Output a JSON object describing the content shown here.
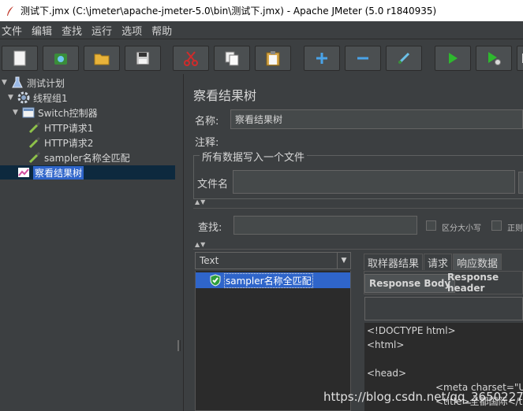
{
  "window": {
    "title": "测试下.jmx (C:\\jmeter\\apache-jmeter-5.0\\bin\\测试下.jmx) - Apache JMeter (5.0 r1840935)"
  },
  "menubar": {
    "items": [
      "文件",
      "编辑",
      "查找",
      "运行",
      "选项",
      "帮助"
    ]
  },
  "toolbar": {
    "buttons": [
      "new-icon",
      "templates-icon",
      "open-icon",
      "save-icon",
      "cut-icon",
      "copy-icon",
      "paste-icon",
      "expand-icon",
      "collapse-icon",
      "toggle-icon",
      "start-icon",
      "start-no-pause-icon",
      "stop-icon"
    ]
  },
  "tree": {
    "items": [
      {
        "label": "测试计划",
        "icon": "test-plan-icon"
      },
      {
        "label": "线程组1",
        "icon": "gear-icon"
      },
      {
        "label": "Switch控制器",
        "icon": "controller-icon"
      },
      {
        "label": "HTTP请求1",
        "icon": "pipette-icon"
      },
      {
        "label": "HTTP请求2",
        "icon": "pipette-icon"
      },
      {
        "label": "sampler名称全匹配",
        "icon": "pipette-icon"
      },
      {
        "label": "察看结果树",
        "icon": "chart-icon"
      }
    ]
  },
  "panel": {
    "title": "察看结果树",
    "name_label": "名称:",
    "name_value": "察看结果树",
    "comment_label": "注释:",
    "comment_value": "",
    "file_group_title": "所有数据写入一个文件",
    "filename_label": "文件名",
    "filename_value": "",
    "search_label": "查找:",
    "search_value": "",
    "case_sensitive_label": "区分大小写",
    "regex_label": "正则"
  },
  "results": {
    "renderer": "Text",
    "rows": [
      {
        "label": "sampler名称全匹配",
        "status": "success"
      }
    ]
  },
  "tabs": [
    "取样器结果",
    "请求",
    "响应数据"
  ],
  "active_tab": "响应数据",
  "subtabs": [
    "Response Body",
    "Response header"
  ],
  "active_subtab": "Response Body",
  "response_lines": [
    "<!DOCTYPE html>",
    "<html>",
    "",
    "<head>",
    "<meta charset=\"UTF",
    "<title>全都国际</title"
  ],
  "watermark": "https://blog.csdn.net/qq_36502272",
  "colors": {
    "background": "#3c3f41",
    "selection": "#2f65ca",
    "success": "#2e9e3d"
  }
}
